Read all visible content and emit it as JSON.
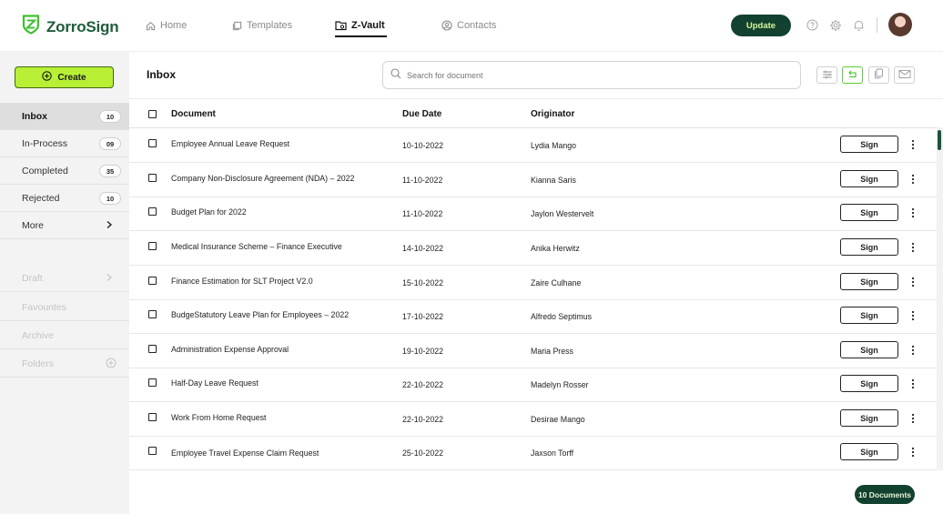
{
  "app": {
    "name": "ZorroSign"
  },
  "nav": {
    "home": "Home",
    "templates": "Templates",
    "zvault": "Z-Vault",
    "contacts": "Contacts"
  },
  "header": {
    "update_label": "Update"
  },
  "sidebar": {
    "create_label": "Create",
    "items": [
      {
        "label": "Inbox",
        "count": "10"
      },
      {
        "label": "In-Process",
        "count": "09"
      },
      {
        "label": "Completed",
        "count": "35"
      },
      {
        "label": "Rejected",
        "count": "10"
      },
      {
        "label": "More"
      }
    ],
    "secondary": [
      {
        "label": "Draft"
      },
      {
        "label": "Favourites"
      },
      {
        "label": "Archive"
      },
      {
        "label": "Folders"
      }
    ]
  },
  "main": {
    "title": "Inbox",
    "search_placeholder": "Search for document",
    "columns": {
      "document": "Document",
      "due_date": "Due Date",
      "originator": "Originator"
    },
    "sign_label": "Sign",
    "rows": [
      {
        "document": "Employee Annual Leave Request",
        "due_date": "10-10-2022",
        "originator": "Lydia Mango"
      },
      {
        "document": "Company Non-Disclosure Agreement (NDA) – 2022",
        "due_date": "11-10-2022",
        "originator": "Kianna Saris"
      },
      {
        "document": "Budget Plan for 2022",
        "due_date": "11-10-2022",
        "originator": "Jaylon Westervelt"
      },
      {
        "document": "Medical Insurance Scheme – Finance Executive",
        "due_date": "14-10-2022",
        "originator": "Anika Herwitz"
      },
      {
        "document": "Finance Estimation for SLT Project V2.0",
        "due_date": "15-10-2022",
        "originator": "Zaire Culhane"
      },
      {
        "document": "BudgeStatutory Leave Plan for Employees – 2022",
        "due_date": "17-10-2022",
        "originator": "Alfredo Septimus"
      },
      {
        "document": "Administration Expense Approval",
        "due_date": "19-10-2022",
        "originator": "Maria Press"
      },
      {
        "document": "Half-Day Leave Request",
        "due_date": "22-10-2022",
        "originator": "Madelyn Rosser"
      },
      {
        "document": "Work From Home Request",
        "due_date": "22-10-2022",
        "originator": "Desirae Mango"
      },
      {
        "document": "Employee Travel Expense Claim Request",
        "due_date": "25-10-2022",
        "originator": "Jaxson Torff"
      }
    ],
    "doc_count": "10 Documents"
  },
  "colors": {
    "brand_dark": "#13412f",
    "accent_lime": "#b7f035",
    "logo_green": "#3fbf2e"
  },
  "icons": [
    "shield-logo-icon",
    "home-icon",
    "templates-icon",
    "vault-icon",
    "contacts-icon",
    "help-icon",
    "gear-icon",
    "bell-icon",
    "plus-circle-icon",
    "chevron-right-icon",
    "search-icon",
    "filter-icon",
    "refresh-icon",
    "copy-icon",
    "mail-icon",
    "kebab-icon"
  ]
}
